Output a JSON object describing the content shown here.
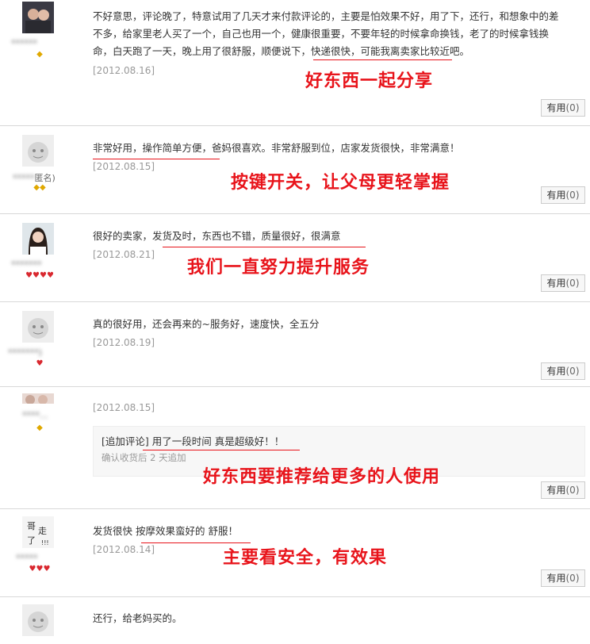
{
  "reviews": [
    {
      "user": "******",
      "level_icons": "◆",
      "content": "不好意思，评论晚了，特意试用了几天才来付款评论的，主要是怕效果不好，用了下，还行，和想象中的差不多，给家里老人买了一个，自己也用一个，健康很重要，不要年轻的时候拿命换钱，老了的时候拿钱换命，白天跑了一天，晚上用了很舒服，顺便说下，快递很快，可能我离卖家比较近吧。",
      "date": "[2012.08.16]",
      "useful_label": "有用",
      "useful_count": "(0)",
      "annotation": "好东西一起分享"
    },
    {
      "user": "*****",
      "user_suffix": "匿名)",
      "level_icons": "◆◆",
      "content": "非常好用，操作简单方便，爸妈很喜欢。非常舒服到位，店家发货很快，非常满意！",
      "date": "[2012.08.15]",
      "useful_label": "有用",
      "useful_count": "(0)",
      "annotation": "按键开关，让父母更轻掌握"
    },
    {
      "user": "*******",
      "level_icons": "♥♥♥♥",
      "content": "很好的卖家，发货及时，东西也不错，质量很好，很满意",
      "date": "[2012.08.21]",
      "useful_label": "有用",
      "useful_count": "(0)",
      "annotation": "我们一直努力提升服务"
    },
    {
      "user": "*******)",
      "level_icons": "♥",
      "content": "真的很好用，还会再来的~服务好，速度快，全五分",
      "date": "[2012.08.19]",
      "useful_label": "有用",
      "useful_count": "(0)"
    },
    {
      "user": "****...",
      "level_icons": "◆",
      "date": "[2012.08.15]",
      "append_text": "[追加评论] 用了一段时间 真是超级好！！",
      "append_sub": "确认收货后 2 天追加",
      "useful_label": "有用",
      "useful_count": "(0)",
      "annotation": "好东西要推荐给更多的人使用"
    },
    {
      "user": "*****",
      "level_icons": "♥♥♥",
      "content": "发货很快 按摩效果蛮好的 舒服！",
      "date": "[2012.08.14]",
      "useful_label": "有用",
      "useful_count": "(0)",
      "annotation": "主要看安全，有效果"
    },
    {
      "content": "还行，给老妈买的。"
    }
  ],
  "colors": {
    "annotation": "#e8141b",
    "border": "#d8d8d8",
    "gold": "#e0a800",
    "heart": "#d9282f"
  }
}
